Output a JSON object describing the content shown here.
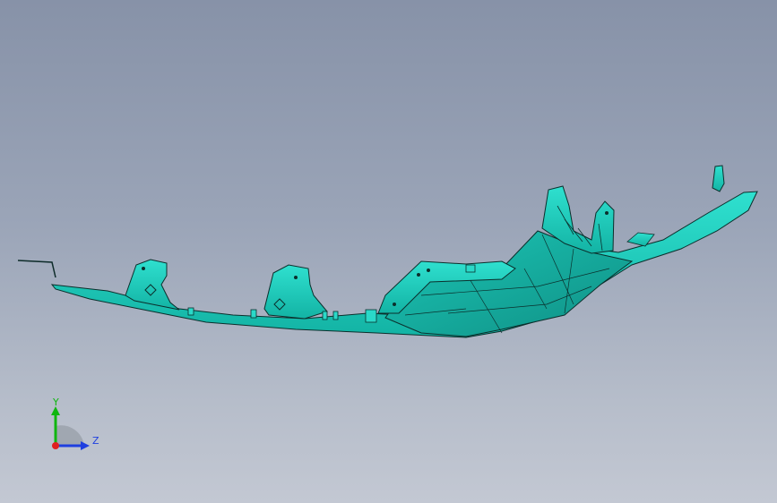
{
  "viewport": {
    "background_top": "#8792a8",
    "background_bottom": "#c3c8d3"
  },
  "model": {
    "icon": "bumper-part-model",
    "face_color": "#1fd1c1",
    "face_color_dark": "#14a99c",
    "edge_color": "#0b2f2c"
  },
  "triad": {
    "y_label": "Y",
    "z_label": "Z",
    "y_color": "#0fb60f",
    "z_color": "#1f3fe0",
    "origin_color": "#e02020"
  }
}
